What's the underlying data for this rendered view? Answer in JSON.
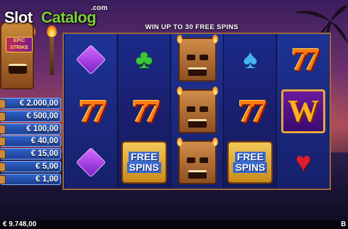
{
  "watermark": {
    "slot": "Slot",
    "catalog": "Catalog",
    "com": ".com"
  },
  "logo": {
    "banner": "EPIC STRIKE"
  },
  "banner": "WIN UP TO 30 FREE SPINS",
  "paytable": [
    "€ 2.000,00",
    "€ 500,00",
    "€ 100,00",
    "€ 40,00",
    "€ 15,00",
    "€ 5,00",
    "€ 1,00"
  ],
  "reels": [
    [
      "purple-diamond",
      "seven",
      "purple-diamond"
    ],
    [
      "green-club",
      "seven",
      "free-spins"
    ],
    [
      "tiki",
      "tiki",
      "tiki"
    ],
    [
      "blue-spade",
      "seven",
      "free-spins"
    ],
    [
      "seven",
      "wild",
      "red-heart"
    ]
  ],
  "symbols": {
    "wild": "W",
    "free_line1": "FREE",
    "free_line2": "SPINS",
    "seven": "77"
  },
  "status": {
    "balance": "€ 9.748,00",
    "bet_label": "B"
  },
  "colors": {
    "reel_bg": "#1b2880",
    "frame": "#9a6a3a",
    "paytable_bg": "#2f63c9",
    "sky_top": "#3a1d5c"
  }
}
